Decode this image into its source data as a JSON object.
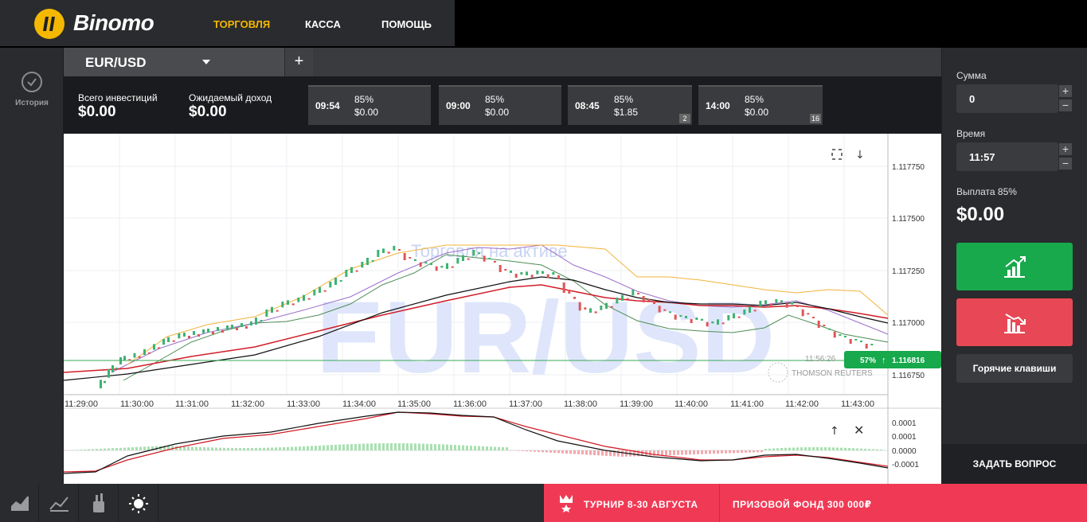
{
  "brand": {
    "name": "Binomo"
  },
  "nav": [
    {
      "label": "ТОРГОВЛЯ",
      "active": true
    },
    {
      "label": "КАССА",
      "active": false
    },
    {
      "label": "ПОМОЩЬ",
      "active": false
    }
  ],
  "sidebar": {
    "history_label": "История"
  },
  "asset_tab": {
    "name": "EUR/USD",
    "add_label": "+"
  },
  "info": {
    "total_invest_label": "Всего инвестиций",
    "total_invest_value": "$0.00",
    "expected_income_label": "Ожидаемый доход",
    "expected_income_value": "$0.00"
  },
  "deals": [
    {
      "time": "09:54",
      "pct": "85%",
      "amount": "$0.00",
      "count": ""
    },
    {
      "time": "09:00",
      "pct": "85%",
      "amount": "$0.00",
      "count": ""
    },
    {
      "time": "08:45",
      "pct": "85%",
      "amount": "$1.85",
      "count": "2"
    },
    {
      "time": "14:00",
      "pct": "85%",
      "amount": "$0.00",
      "count": "16"
    }
  ],
  "chart": {
    "watermark": "EUR/USD",
    "trading_label": "Торговля на активе",
    "price_tag": "1.116816",
    "cursor_time": "11:56:26",
    "percent": "57%",
    "source": "THOMSON REUTERS",
    "y_ticks": [
      "1.117750",
      "1.117500",
      "1.117250",
      "1.117000",
      "1.116750"
    ],
    "x_ticks": [
      "11:29:00",
      "11:30:00",
      "11:31:00",
      "11:32:00",
      "11:33:00",
      "11:34:00",
      "11:35:00",
      "11:36:00",
      "11:37:00",
      "11:38:00",
      "11:39:00",
      "11:40:00",
      "11:41:00",
      "11:42:00",
      "11:43:00"
    ],
    "macd_ticks": [
      "0.0001",
      "0.0001",
      "0.0000",
      "-0.0001"
    ]
  },
  "panel": {
    "sum_label": "Сумма",
    "sum_value": "0",
    "time_label": "Время",
    "time_value": "11:57",
    "payout_label": "Выплата 85%",
    "payout_value": "$0.00",
    "hotkeys_label": "Горячие клавиши",
    "ask_label": "ЗАДАТЬ ВОПРОС",
    "plus": "+",
    "minus": "−"
  },
  "promo": {
    "tournament": "ТУРНИР  8-30 АВГУСТА",
    "prize": "ПРИЗОВОЙ ФОНД 300 000₽"
  },
  "colors": {
    "accent": "#f5b800",
    "up": "#17a94c",
    "down": "#e84855",
    "promo": "#f03a55"
  }
}
